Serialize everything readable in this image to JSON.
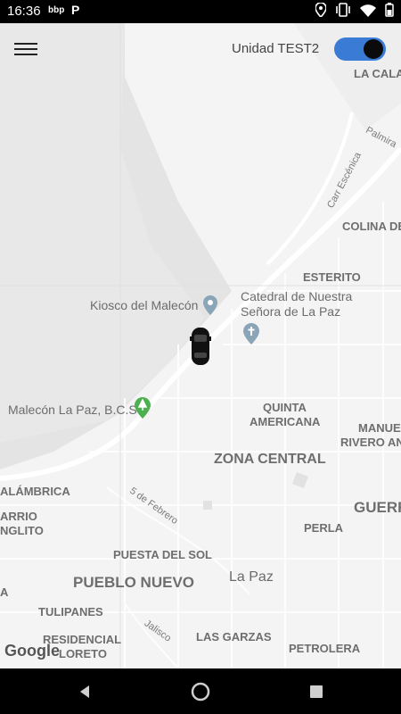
{
  "status_bar": {
    "time": "16:36",
    "app_icons": [
      "bbp",
      "P"
    ],
    "icons": [
      "location-icon",
      "vibrate-icon",
      "wifi-icon",
      "battery-icon"
    ]
  },
  "header": {
    "menu_icon": "hamburger-menu-icon",
    "unit_label": "Unidad TEST2",
    "toggle_on": true,
    "toggle_color": "#3a7bd5"
  },
  "map": {
    "areas": [
      {
        "text": "LA CALA"
      },
      {
        "text": "COLINA DE"
      },
      {
        "text": "ESTERITO"
      },
      {
        "text": "QUINTA"
      },
      {
        "text": "AMERICANA"
      },
      {
        "text": "MANUE"
      },
      {
        "text": "RIVERO AN"
      },
      {
        "text": "ZONA CENTRAL"
      },
      {
        "text": "ALÁMBRICA"
      },
      {
        "text": "ARRIO"
      },
      {
        "text": "NGLITO"
      },
      {
        "text": "GUERR"
      },
      {
        "text": "PERLA"
      },
      {
        "text": "PUESTA DEL SOL"
      },
      {
        "text": "PUEBLO NUEVO"
      },
      {
        "text": "La Paz"
      },
      {
        "text": "TULIPANES"
      },
      {
        "text": "RESIDENCIAL"
      },
      {
        "text": "LORETO"
      },
      {
        "text": "LAS GARZAS"
      },
      {
        "text": "PETROLERA"
      },
      {
        "text": "A"
      }
    ],
    "pois": [
      {
        "text": "Kiosco del Malecón"
      },
      {
        "text": "Catedral de Nuestra"
      },
      {
        "text": "Señora de La Paz"
      },
      {
        "text": "Malecón La Paz, B.C.S"
      }
    ],
    "streets": [
      {
        "text": "Palmira"
      },
      {
        "text": "Carr Escénica"
      },
      {
        "text": "5 de Febrero"
      },
      {
        "text": "Jalisco"
      }
    ],
    "vehicle_icon": "car-icon",
    "google_logo": "Google"
  },
  "nav_bar": {
    "buttons": [
      "back-icon",
      "home-icon",
      "recents-icon"
    ]
  }
}
